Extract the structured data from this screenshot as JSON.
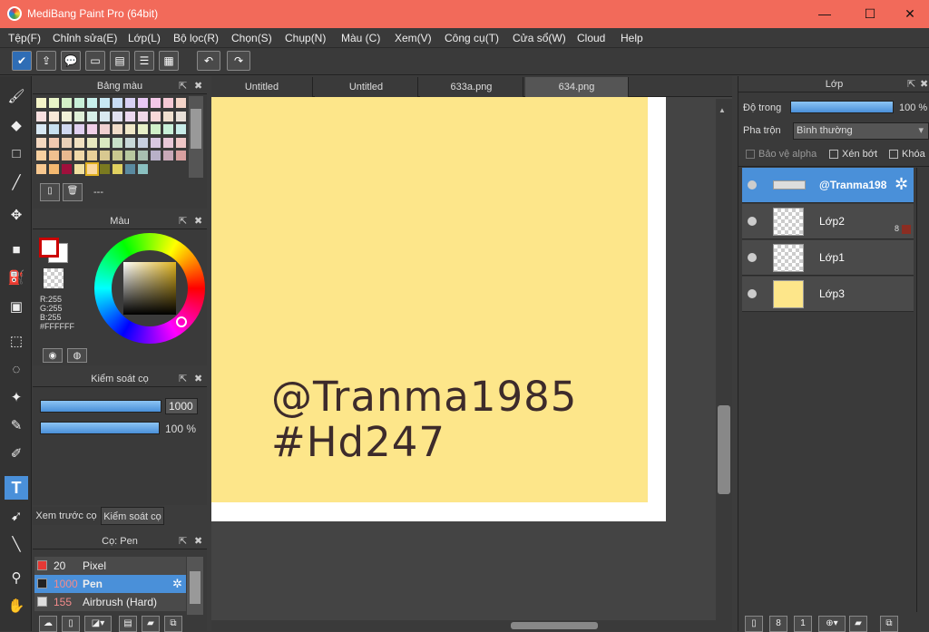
{
  "window": {
    "title": "MediBang Paint Pro (64bit)",
    "minimize": "—",
    "maximize": "☐",
    "close": "✕"
  },
  "menu": [
    "Tệp(F)",
    "Chỉnh sửa(E)",
    "Lớp(L)",
    "Bộ lọc(R)",
    "Chọn(S)",
    "Chụp(N)",
    "Màu (C)",
    "Xem(V)",
    "Công cụ(T)",
    "Cửa sổ(W)",
    "Cloud",
    "Help"
  ],
  "palette": {
    "title": "Bảng màu",
    "name": "---"
  },
  "color": {
    "title": "Màu",
    "r": "R:255",
    "g": "G:255",
    "b": "B:255",
    "hex": "#FFFFFF",
    "accent": "#4a90d9"
  },
  "brush_control": {
    "title": "Kiểm soát cọ",
    "size": "1000",
    "opacity": "100 %"
  },
  "bottom_tabs": {
    "preview": "Xem trước cọ",
    "control": "Kiểm soát cọ"
  },
  "brush_list": {
    "title": "Cọ: Pen",
    "items": [
      {
        "size": "20",
        "name": "Pixel",
        "color": "#e53935"
      },
      {
        "size": "1000",
        "name": "Pen",
        "color": "#222222"
      },
      {
        "size": "155",
        "name": "Airbrush (Hard)",
        "color": "#dddddd"
      }
    ]
  },
  "tabs": [
    "Untitled",
    "Untitled",
    "633a.png",
    "634.png"
  ],
  "canvas": {
    "line1": "@Tranma1985",
    "line2": "#Hd247",
    "bg": "#fde68a"
  },
  "layers": {
    "title": "Lớp",
    "opacity_label": "Độ trong",
    "opacity_value": "100 %",
    "blend_label": "Pha trộn",
    "blend_value": "Bình thường",
    "protect_alpha": "Bảo vệ alpha",
    "clipping": "Xén bớt",
    "lock": "Khóa",
    "items": [
      {
        "name": "@Tranma198",
        "selected": true
      },
      {
        "name": "Lớp2",
        "badge": "8"
      },
      {
        "name": "Lớp1"
      },
      {
        "name": "Lớp3"
      }
    ]
  }
}
